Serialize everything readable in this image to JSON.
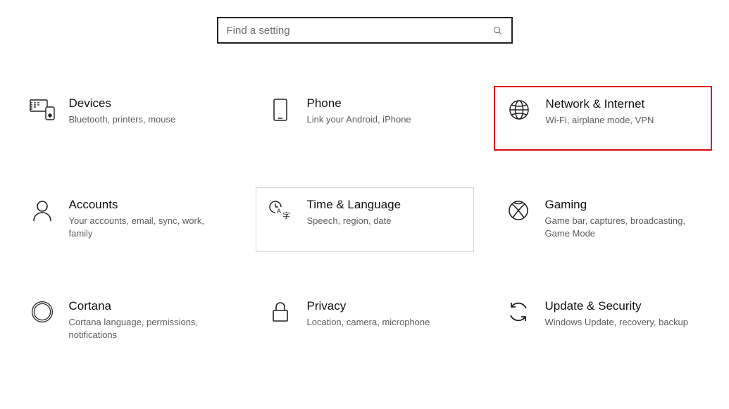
{
  "search": {
    "placeholder": "Find a setting"
  },
  "tiles": {
    "devices": {
      "title": "Devices",
      "desc": "Bluetooth, printers, mouse"
    },
    "phone": {
      "title": "Phone",
      "desc": "Link your Android, iPhone"
    },
    "network": {
      "title": "Network & Internet",
      "desc": "Wi-Fi, airplane mode, VPN"
    },
    "accounts": {
      "title": "Accounts",
      "desc": "Your accounts, email, sync, work, family"
    },
    "time": {
      "title": "Time & Language",
      "desc": "Speech, region, date"
    },
    "gaming": {
      "title": "Gaming",
      "desc": "Game bar, captures, broadcasting, Game Mode"
    },
    "cortana": {
      "title": "Cortana",
      "desc": "Cortana language, permissions, notifications"
    },
    "privacy": {
      "title": "Privacy",
      "desc": "Location, camera, microphone"
    },
    "update": {
      "title": "Update & Security",
      "desc": "Windows Update, recovery, backup"
    }
  }
}
